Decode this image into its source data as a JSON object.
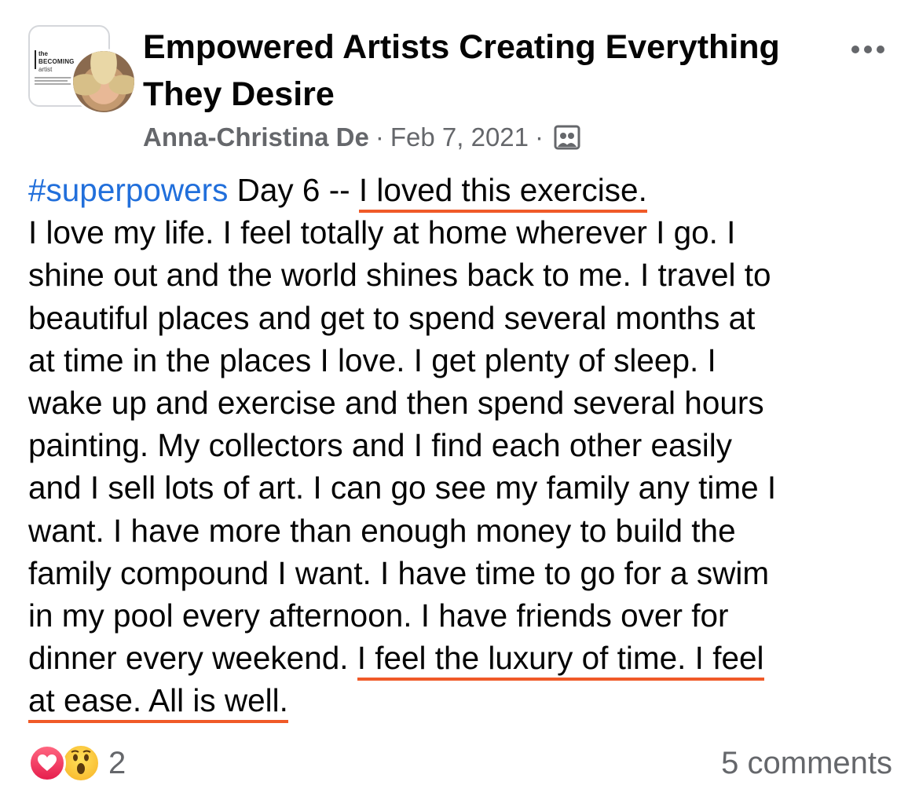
{
  "group": {
    "thumb_line1": "the",
    "thumb_line2": "BECOMING",
    "thumb_line3": "artist",
    "title": "Empowered Artists Creating Everything They Desire"
  },
  "meta": {
    "author": "Anna-Christina De",
    "separator": "·",
    "date": "Feb 7, 2021",
    "audience_icon": "group-audience-icon"
  },
  "post": {
    "hashtag": "#superpowers",
    "line1_rest": " Day 6 -- ",
    "line1_highlight": "I loved this exercise.",
    "lines": [
      "I love my life.  I feel totally at home wherever I go.  I",
      "shine out and the world shines back to me.  I travel to",
      "beautiful places and get to spend several months at",
      "at time in the places I love.  I get plenty of sleep.  I",
      "wake up and exercise and then spend several hours",
      "painting.  My collectors and I find each other easily",
      "and I sell lots of art.  I can go see my family any time I",
      "want.  I have more than enough money to build the",
      "family compound I want.  I have time to go for a swim",
      "in my pool every afternoon.  I have friends over for"
    ],
    "line12_plain": "dinner every weekend.  ",
    "line12_highlight": "I feel the luxury of time.  I feel",
    "line13_highlight": "at ease.  All is well."
  },
  "footer": {
    "reaction_icons": [
      "love-icon",
      "wow-icon"
    ],
    "reaction_count": "2",
    "comments": "5 comments"
  },
  "colors": {
    "hashtag": "#216fdb",
    "highlight_underline": "#f05a28",
    "meta_text": "#65676b"
  }
}
